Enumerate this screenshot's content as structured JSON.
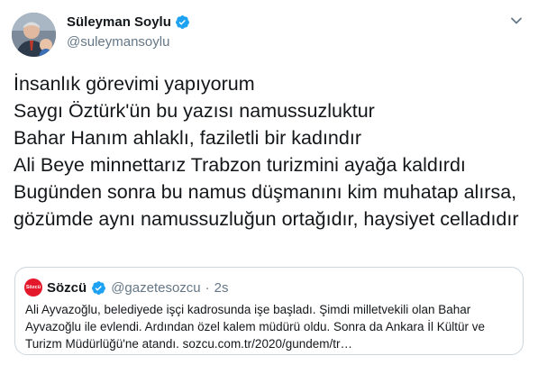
{
  "author": {
    "name": "Süleyman Soylu",
    "handle": "@suleymansoylu",
    "avatar_icon": "profile-photo-icon"
  },
  "tweet_text": "İnsanlık görevimi yapıyorum\nSaygı Öztürk'ün bu yazısı namussuzluktur\nBahar Hanım ahlaklı, faziletli bir kadındır\nAli Beye minnettarız Trabzon turizmini ayağa kaldırdı\nBugünden sonra bu namus düşmanını kim muhatap alırsa, gözümde aynı namussuzluğun ortağıdır, haysiyet celladıdır",
  "quoted": {
    "logo_text": "Sözcü",
    "name": "Sözcü",
    "handle": "@gazetesozcu",
    "separator": "·",
    "time": "2s",
    "text": "Ali Ayvazoğlu, belediyede işçi kadrosunda işe başladı. Şimdi milletvekili olan Bahar Ayvazoğlu ile evlendi. Ardından özel kalem müdürü oldu. Sonra da Ankara İl Kültür ve Turizm Müdürlüğü'ne atandı. sozcu.com.tr/2020/gundem/tr…"
  },
  "colors": {
    "verified_blue": "#1da1f2",
    "sozcu_red": "#e3182a",
    "secondary_text": "#657786",
    "border": "#ccd6dd"
  }
}
